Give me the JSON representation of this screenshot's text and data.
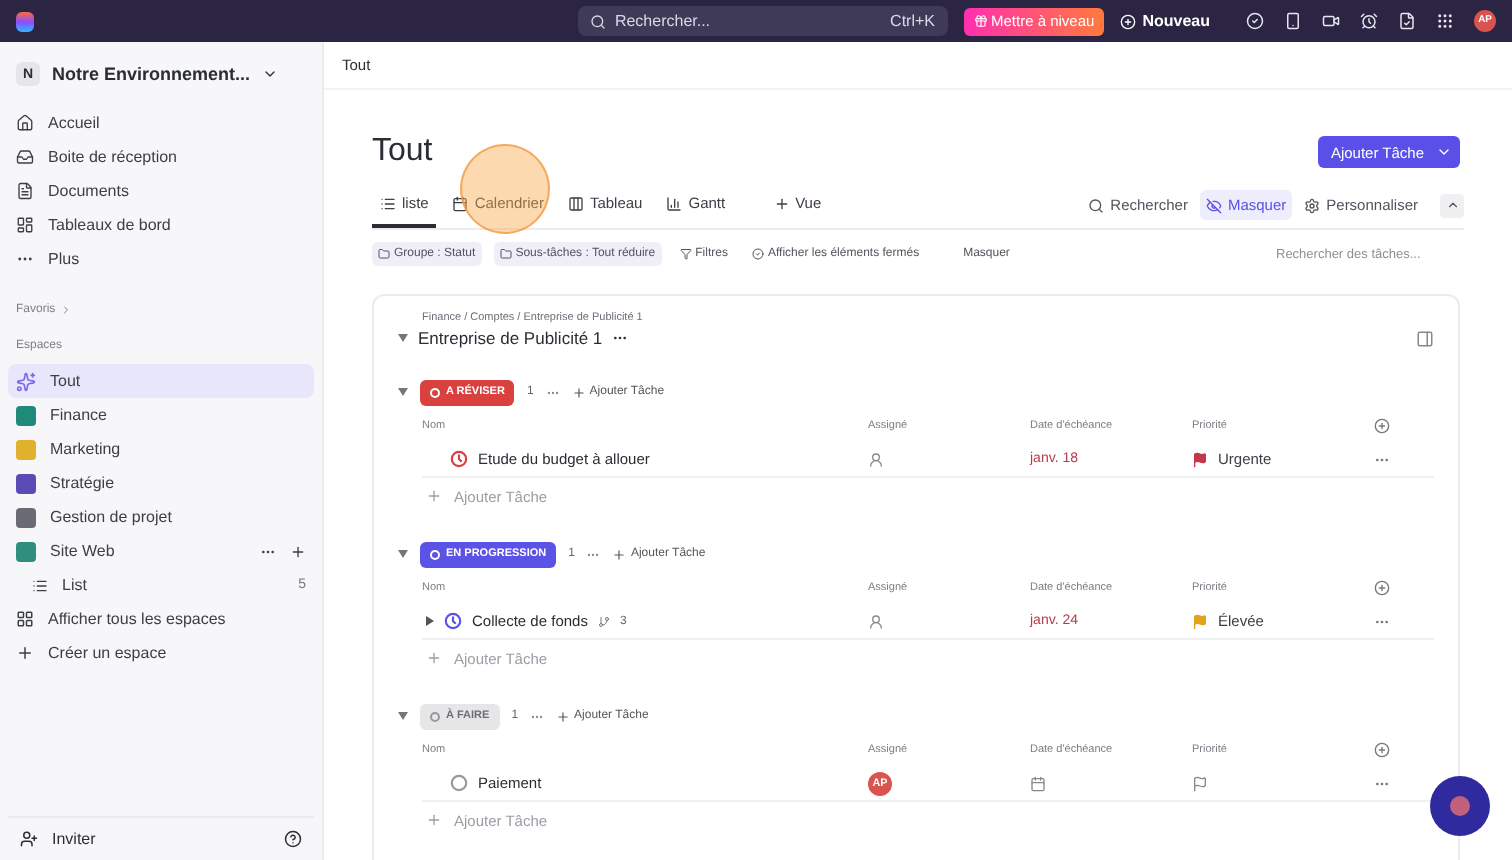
{
  "topbar": {
    "search_placeholder": "Rechercher...",
    "shortcut": "Ctrl+K",
    "upgrade": "Mettre à niveau",
    "new": "Nouveau",
    "avatar": "AP"
  },
  "sidebar": {
    "workspace": "Notre Environnement...",
    "workspace_initial": "N",
    "nav": [
      {
        "label": "Accueil",
        "kind": "home"
      },
      {
        "label": "Boite de réception",
        "kind": "inbox"
      },
      {
        "label": "Documents",
        "kind": "doc"
      },
      {
        "label": "Tableaux de bord",
        "kind": "dashboard"
      },
      {
        "label": "Plus",
        "kind": "more"
      }
    ],
    "favorites": "Favoris",
    "spaces_label": "Espaces",
    "spaces": [
      {
        "label": "Tout",
        "selected": true,
        "color": "#7b68ee",
        "kind": "all"
      },
      {
        "label": "Finance",
        "selected": false,
        "color": "#1f8a7a",
        "kind": "space"
      },
      {
        "label": "Marketing",
        "selected": false,
        "color": "#e0b12d",
        "kind": "space"
      },
      {
        "label": "Stratégie",
        "selected": false,
        "color": "#5b4bb7",
        "kind": "space"
      },
      {
        "label": "Gestion de projet",
        "selected": false,
        "color": "#6b6b73",
        "kind": "space"
      },
      {
        "label": "Site Web",
        "selected": false,
        "color": "#2f8f7c",
        "kind": "space",
        "children": [
          {
            "label": "List",
            "count": "5"
          }
        ]
      }
    ],
    "show_all": "Afficher tous les espaces",
    "create": "Créer un espace",
    "invite": "Inviter"
  },
  "breadcrumb": "Tout",
  "title": "Tout",
  "add_task": "Ajouter Tâche",
  "views": [
    {
      "label": "liste",
      "selected": true,
      "kind": "list"
    },
    {
      "label": "Calendrier",
      "selected": false,
      "kind": "calendar"
    },
    {
      "label": "Tableau",
      "selected": false,
      "kind": "board"
    },
    {
      "label": "Gantt",
      "selected": false,
      "kind": "gantt"
    },
    {
      "label": "Vue",
      "selected": false,
      "kind": "add"
    }
  ],
  "view_actions": [
    {
      "label": "Rechercher",
      "selected": false,
      "kind": "search"
    },
    {
      "label": "Masquer",
      "selected": true,
      "kind": "hide"
    },
    {
      "label": "Personnaliser",
      "selected": false,
      "kind": "settings"
    }
  ],
  "filters": [
    {
      "label": "Groupe : Statut",
      "kind": "chip"
    },
    {
      "label": "Sous-tâches : Tout réduire",
      "kind": "chip"
    },
    {
      "label": "Filtres",
      "kind": "filter"
    },
    {
      "label": "Afficher les éléments fermés",
      "kind": "closed"
    },
    {
      "label": "Masquer",
      "kind": "plain"
    }
  ],
  "task_search_placeholder": "Rechercher des tâches...",
  "list": {
    "path": "Finance / Comptes / Entreprise de Publicité 1",
    "title": "Entreprise de Publicité 1",
    "groups": [
      {
        "status": "A RÉVISER",
        "color": "#d9413f",
        "count": "1",
        "add": "Ajouter Tâche",
        "columns": [
          "Nom",
          "Assigné",
          "Date d'échéance",
          "Priorité"
        ],
        "tasks": [
          {
            "name": "Etude du budget à allouer",
            "due": "janv. 18",
            "priority": "Urgente",
            "color": "#c2374a"
          }
        ],
        "add_row": "Ajouter Tâche"
      },
      {
        "status": "EN PROGRESSION",
        "color": "#5b52e6",
        "count": "1",
        "add": "Ajouter Tâche",
        "columns": [
          "Nom",
          "Assigné",
          "Date d'échéance",
          "Priorité"
        ],
        "tasks": [
          {
            "name": "Collecte de fonds",
            "subtasks": "3",
            "due": "janv. 24",
            "priority": "Élevée",
            "color": "#e3a41c"
          }
        ],
        "add_row": "Ajouter Tâche"
      },
      {
        "status": "À FAIRE",
        "color": "#e6e6e9",
        "count": "1",
        "add": "Ajouter Tâche",
        "columns": [
          "Nom",
          "Assigné",
          "Date d'échéance",
          "Priorité"
        ],
        "tasks": [
          {
            "name": "Paiement",
            "assignee": "AP"
          }
        ],
        "add_row": "Ajouter Tâche"
      }
    ]
  }
}
